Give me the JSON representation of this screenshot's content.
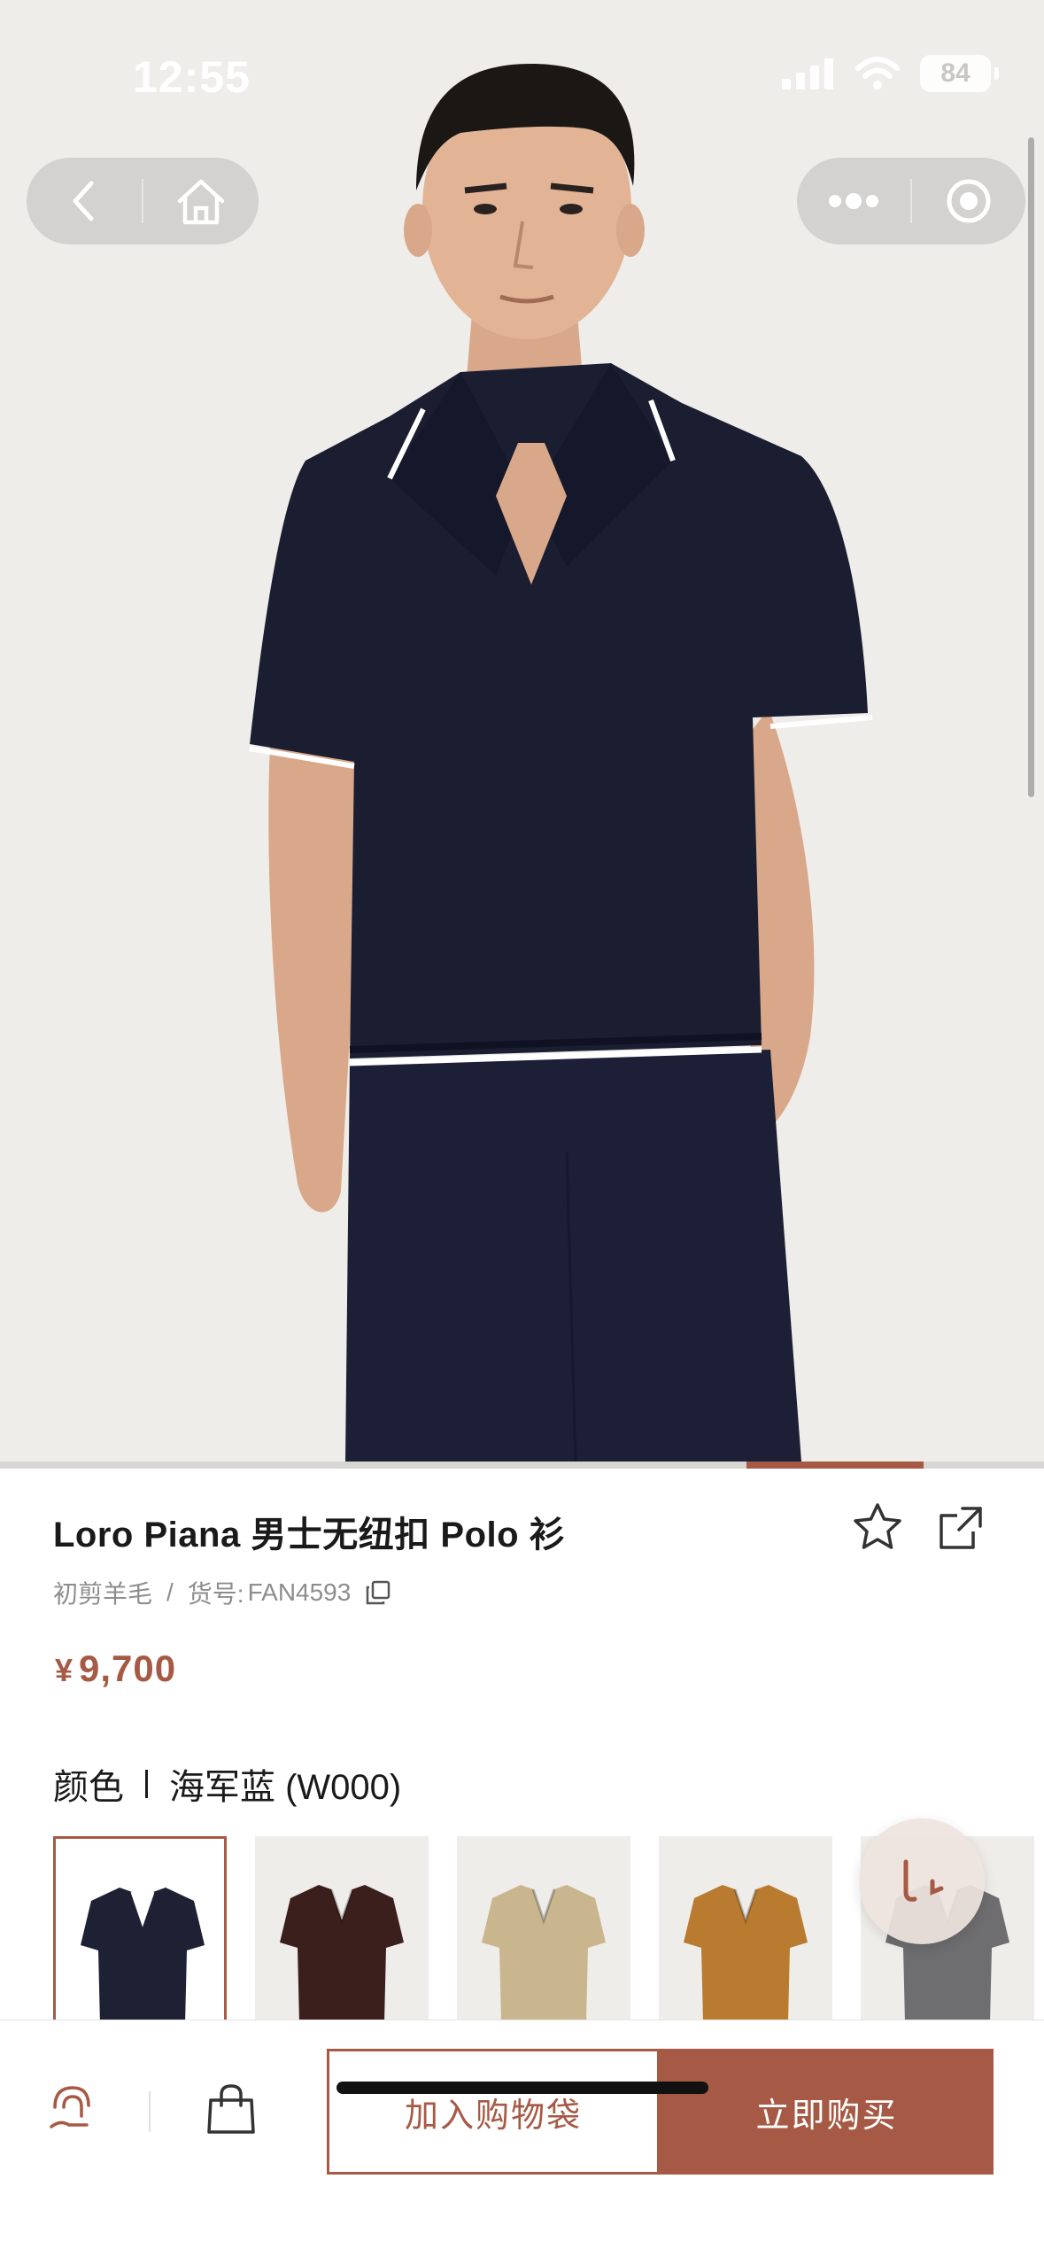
{
  "status_bar": {
    "time": "12:55",
    "battery": "84"
  },
  "nav": {
    "back_icon": "chevron-left-icon",
    "home_icon": "home-icon",
    "more_icon": "more-dots-icon",
    "close_icon": "target-close-icon"
  },
  "carousel": {
    "progress": 0.17,
    "progress_start": 0.715
  },
  "product": {
    "title": "Loro Piana 男士无纽扣 Polo 衫",
    "material": "初剪羊毛",
    "sku_label": "货号:",
    "sku": "FAN4593",
    "meta_sep": "/",
    "currency": "¥",
    "price": "9,700",
    "favorite_icon": "star-icon",
    "share_icon": "share-icon",
    "copy_icon": "copy-icon"
  },
  "color": {
    "label": "颜色",
    "value": "海军蓝 (W000)",
    "swatches": [
      {
        "name": "navy",
        "hex": "#1e2133",
        "selected": true
      },
      {
        "name": "brown",
        "hex": "#3b1f1c",
        "selected": false
      },
      {
        "name": "beige",
        "hex": "#c9b68f",
        "selected": false
      },
      {
        "name": "ochre",
        "hex": "#b87b30",
        "selected": false
      },
      {
        "name": "grey",
        "hex": "#6e6e70",
        "selected": false
      }
    ]
  },
  "bottom_bar": {
    "service_icon": "customer-service-icon",
    "bag_icon": "shopping-bag-icon",
    "add_to_bag": "加入购物袋",
    "buy_now": "立即购买"
  },
  "colors": {
    "accent": "#a65a45",
    "background": "#efedea"
  }
}
